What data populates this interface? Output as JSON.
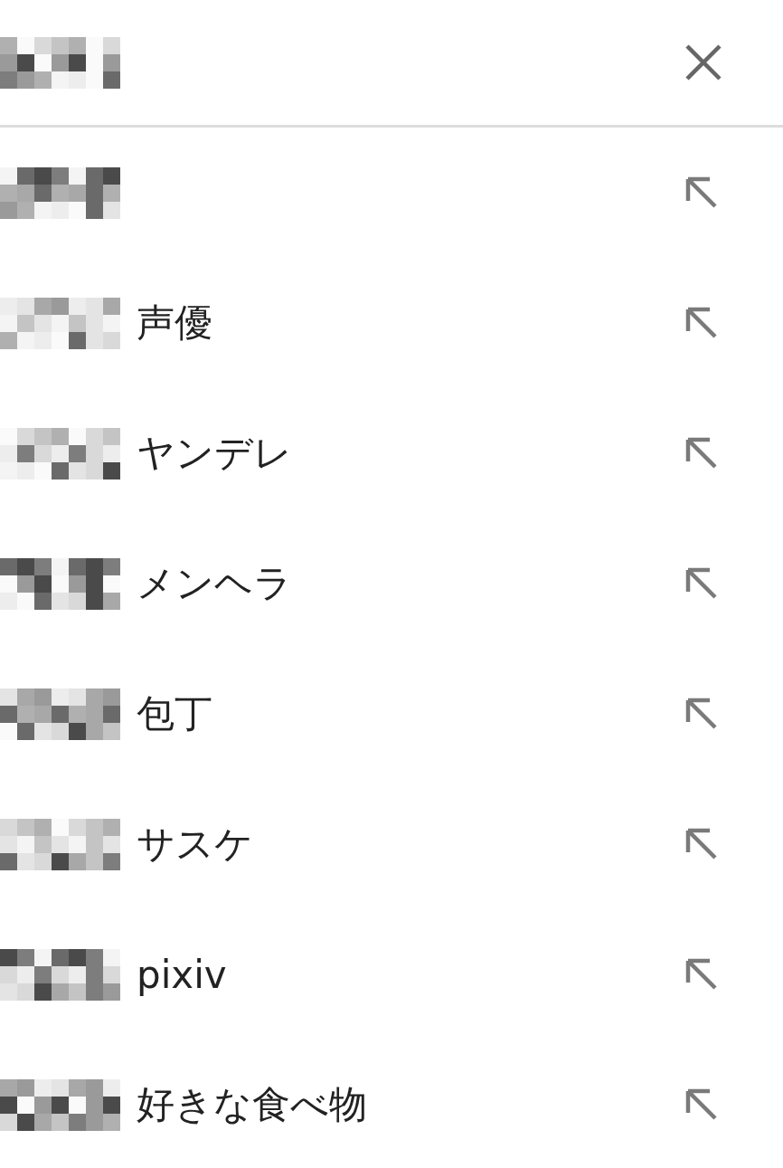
{
  "header": {
    "query_redacted": true
  },
  "suggestions": [
    {
      "redacted_prefix": true
    },
    {
      "redacted_prefix": true,
      "text": "声優"
    },
    {
      "redacted_prefix": true,
      "text": "ヤンデレ"
    },
    {
      "redacted_prefix": true,
      "text": "メンヘラ"
    },
    {
      "redacted_prefix": true,
      "text": "包丁"
    },
    {
      "redacted_prefix": true,
      "text": "サスケ"
    },
    {
      "redacted_prefix": true,
      "text": "pixiv"
    },
    {
      "redacted_prefix": true,
      "text": "好きな食べ物"
    }
  ]
}
